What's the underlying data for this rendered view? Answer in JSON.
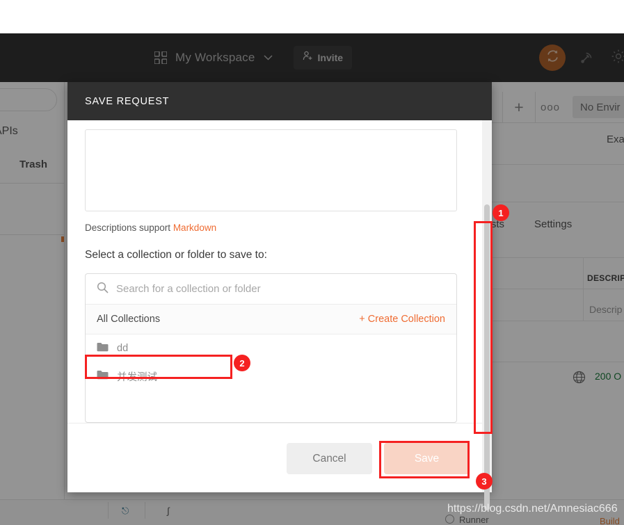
{
  "header": {
    "workspace_name": "My Workspace",
    "invite_label": "Invite",
    "grid_icon": "grid-icon",
    "chevron_icon": "chevron-down-icon",
    "invite_icon": "user-plus-icon",
    "sync_icon": "sync-icon",
    "broadcast_icon": "broadcast-icon",
    "settings_icon": "gear-icon",
    "bar_color": "#333333",
    "sync_circle_color": "#b0622c"
  },
  "sidebar": {
    "apis_label": "APIs",
    "trash_label": "Trash",
    "search_placeholder": ""
  },
  "workbench": {
    "new_tab_label": "+",
    "tab_options_label": "ooo",
    "environment_label": "No Envir",
    "example_label": "Exa",
    "tab_tests": "Tests",
    "tab_settings": "Settings",
    "column_description": "DESCRIP",
    "cell_description": "Descrip",
    "status_text": "200 O",
    "globe_icon": "globe-icon",
    "status_color": "#1a7a3c"
  },
  "modal": {
    "title": "SAVE REQUEST",
    "description_value": "",
    "markdown_note_prefix": "Descriptions support ",
    "markdown_link": "Markdown",
    "select_label": "Select a collection or folder to save to:",
    "picker": {
      "search_placeholder": "Search for a collection or folder",
      "search_icon": "search-icon",
      "all_collections_label": "All Collections",
      "create_collection_label": "+ Create Collection",
      "folders": [
        {
          "name": "dd",
          "icon": "folder-icon"
        },
        {
          "name": "并发测试",
          "icon": "folder-icon"
        }
      ]
    },
    "cancel_label": "Cancel",
    "save_label": "Save",
    "accent_color": "#ef6c33",
    "save_button_color": "#f9d4c5"
  },
  "annotations": {
    "badge_color": "#f52121",
    "items": [
      {
        "number": "1",
        "target": "modal-scrollbar"
      },
      {
        "number": "2",
        "target": "folder-row-bingfaceshi"
      },
      {
        "number": "3",
        "target": "save-button"
      }
    ]
  },
  "watermark": {
    "text": "https://blog.csdn.net/Amnesiac666"
  },
  "statusbar": {
    "build_label": "Build",
    "runner_label": "Runner"
  }
}
